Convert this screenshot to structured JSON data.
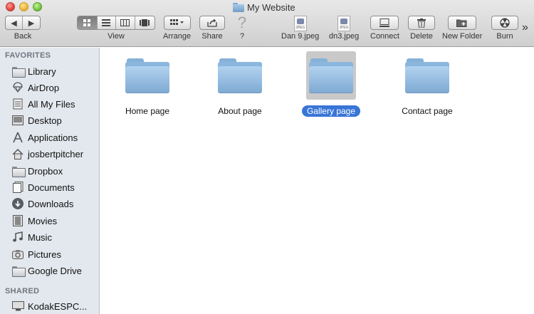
{
  "window": {
    "title": "My Website"
  },
  "toolbar": {
    "back_label": "Back",
    "view_label": "View",
    "arrange_label": "Arrange",
    "share_label": "Share",
    "help_label": "?",
    "file1_label": "Dan 9.jpeg",
    "file2_label": "dn3.jpeg",
    "connect_label": "Connect",
    "delete_label": "Delete",
    "new_folder_label": "New Folder",
    "burn_label": "Burn",
    "overflow": "»",
    "back_glyph": "◀",
    "forward_glyph": "▶",
    "help_glyph": "?"
  },
  "sidebar": {
    "favorites_heading": "FAVORITES",
    "shared_heading": "SHARED",
    "favorites": [
      {
        "label": "Library",
        "icon": "folder-icon"
      },
      {
        "label": "AirDrop",
        "icon": "airdrop-icon"
      },
      {
        "label": "All My Files",
        "icon": "all-files-icon"
      },
      {
        "label": "Desktop",
        "icon": "desktop-icon"
      },
      {
        "label": "Applications",
        "icon": "applications-icon"
      },
      {
        "label": "josbertpitcher",
        "icon": "home-icon"
      },
      {
        "label": "Dropbox",
        "icon": "folder-icon"
      },
      {
        "label": "Documents",
        "icon": "documents-icon"
      },
      {
        "label": "Downloads",
        "icon": "downloads-icon"
      },
      {
        "label": "Movies",
        "icon": "movies-icon"
      },
      {
        "label": "Music",
        "icon": "music-icon"
      },
      {
        "label": "Pictures",
        "icon": "pictures-icon"
      },
      {
        "label": "Google Drive",
        "icon": "folder-icon"
      }
    ],
    "shared": [
      {
        "label": "KodakESPC...",
        "icon": "computer-icon"
      }
    ]
  },
  "content": {
    "items": [
      {
        "label": "Home page",
        "selected": false
      },
      {
        "label": "About page",
        "selected": false
      },
      {
        "label": "Gallery page",
        "selected": true
      },
      {
        "label": "Contact page",
        "selected": false
      }
    ]
  },
  "colors": {
    "selection": "#3875d7",
    "sidebar_bg": "#e3e8ee",
    "folder_blue": "#8bb6dd"
  }
}
